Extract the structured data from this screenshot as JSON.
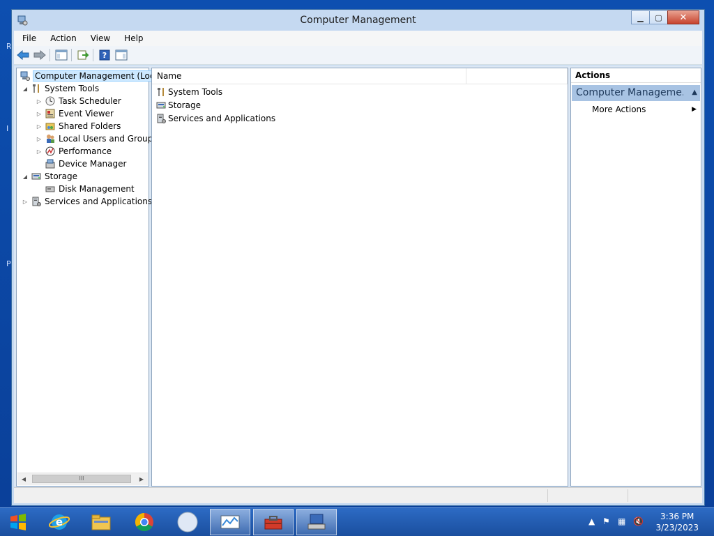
{
  "window": {
    "title": "Computer Management"
  },
  "menu": [
    "File",
    "Action",
    "View",
    "Help"
  ],
  "tree": {
    "root": "Computer Management (Local",
    "system_tools": "System Tools",
    "task_scheduler": "Task Scheduler",
    "event_viewer": "Event Viewer",
    "shared_folders": "Shared Folders",
    "local_users": "Local Users and Groups",
    "performance": "Performance",
    "device_manager": "Device Manager",
    "storage": "Storage",
    "disk_management": "Disk Management",
    "services_apps": "Services and Applications"
  },
  "list": {
    "column_name": "Name",
    "items": [
      "System Tools",
      "Storage",
      "Services and Applications"
    ]
  },
  "actions": {
    "header": "Actions",
    "section": "Computer Manageme...",
    "more_actions": "More Actions"
  },
  "scrollbar": {
    "thumb_grip": "III"
  },
  "taskbar": {
    "time": "3:36 PM",
    "date": "3/23/2023"
  },
  "desktop_letters": [
    "R",
    "I",
    "P"
  ],
  "colors": {
    "accent": "#c5d9f1",
    "selection": "#cce8ff",
    "taskbar": "#1a4e9e",
    "close_button": "#c7432e"
  }
}
